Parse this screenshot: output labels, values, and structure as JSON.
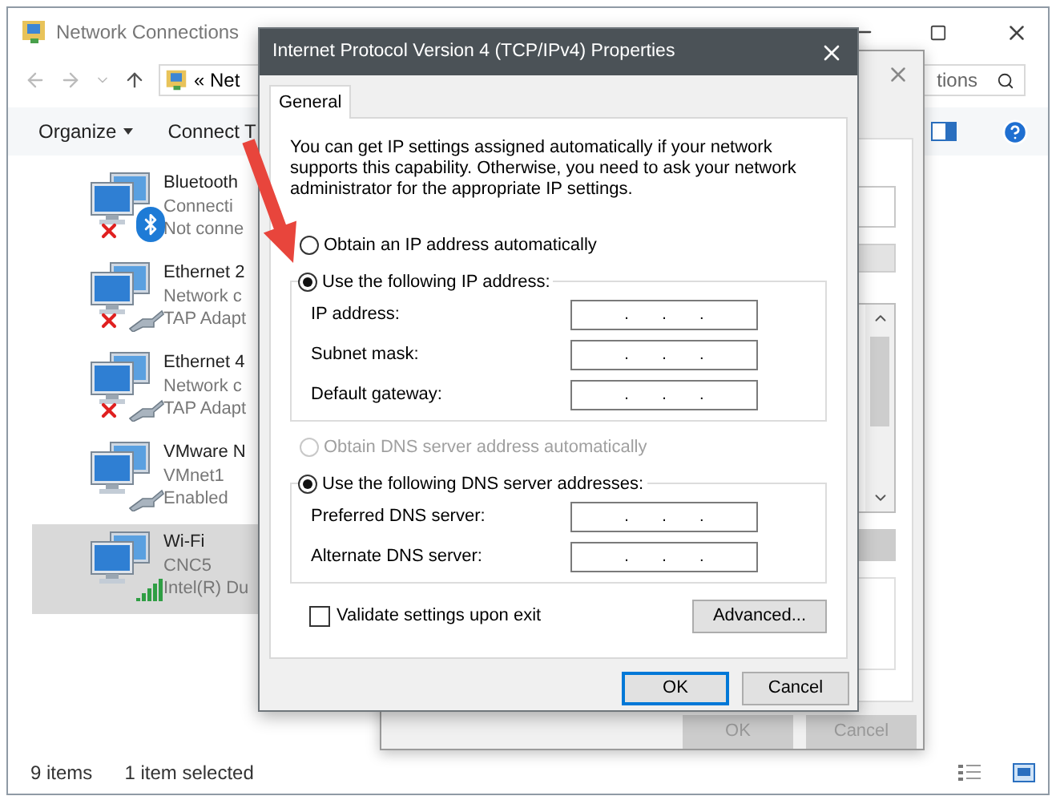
{
  "explorer": {
    "title": "Network Connections",
    "address": "« Net",
    "search_placeholder": "tions",
    "toolbar": [
      {
        "label": "Organize",
        "kind": "menu"
      },
      {
        "label": "Connect T",
        "kind": "plain"
      }
    ],
    "items": [
      {
        "lines": [
          "Bluetooth",
          "Connecti",
          "Not conne"
        ],
        "kind": "bluetooth",
        "disconnected": true,
        "selected": false
      },
      {
        "lines": [
          "Ethernet 2",
          "Network c",
          "TAP Adapt"
        ],
        "kind": "cable",
        "disconnected": true,
        "selected": false
      },
      {
        "lines": [
          "Ethernet 4",
          "Network c",
          "TAP Adapt"
        ],
        "kind": "cable",
        "disconnected": true,
        "selected": false
      },
      {
        "lines": [
          "VMware N",
          "VMnet1",
          "Enabled"
        ],
        "kind": "cable",
        "disconnected": false,
        "selected": false
      },
      {
        "lines": [
          "Wi-Fi",
          "CNC5",
          "Intel(R) Du"
        ],
        "kind": "wifi",
        "disconnected": false,
        "selected": true
      }
    ],
    "status_bar": {
      "count": "9 items",
      "selection": "1 item selected"
    }
  },
  "background_dialog": {
    "buttons": [
      {
        "label": "OK",
        "disabled": true
      },
      {
        "label": "Cancel",
        "disabled": true
      }
    ]
  },
  "dialog": {
    "title": "Internet Protocol Version 4 (TCP/IPv4) Properties",
    "tabs": [
      {
        "label": "General",
        "selected": true
      }
    ],
    "description": "You can get IP settings assigned automatically if your network supports this capability. Otherwise, you need to ask your network administrator for the appropriate IP settings.",
    "ip_options": [
      {
        "label": "Obtain an IP address automatically",
        "selected": false,
        "disabled": false
      },
      {
        "label": "Use the following IP address:",
        "selected": true,
        "disabled": false
      }
    ],
    "ip_fields": [
      {
        "label": "IP address:",
        "dots": [
          ".",
          ".",
          "."
        ]
      },
      {
        "label": "Subnet mask:",
        "dots": [
          ".",
          ".",
          "."
        ]
      },
      {
        "label": "Default gateway:",
        "dots": [
          ".",
          ".",
          "."
        ]
      }
    ],
    "dns_options": [
      {
        "label": "Obtain DNS server address automatically",
        "selected": false,
        "disabled": true
      },
      {
        "label": "Use the following DNS server addresses:",
        "selected": true,
        "disabled": false
      }
    ],
    "dns_fields": [
      {
        "label": "Preferred DNS server:",
        "dots": [
          ".",
          ".",
          "."
        ]
      },
      {
        "label": "Alternate DNS server:",
        "dots": [
          ".",
          ".",
          "."
        ]
      }
    ],
    "validate": {
      "label": "Validate settings upon exit",
      "checked": false
    },
    "advanced_button": "Advanced...",
    "buttons": [
      {
        "label": "OK",
        "default": true
      },
      {
        "label": "Cancel",
        "default": false
      }
    ]
  }
}
